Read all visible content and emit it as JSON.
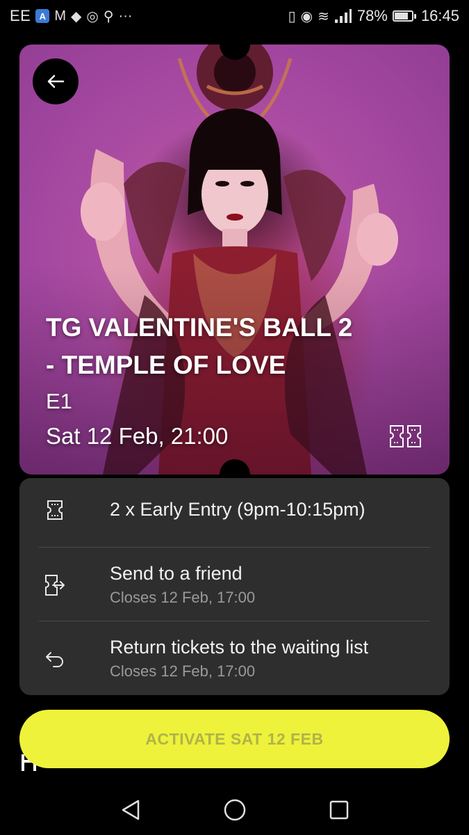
{
  "status_bar": {
    "carrier": "EE",
    "more": "···",
    "battery_percent": "78%",
    "battery_level": 0.78,
    "time": "16:45"
  },
  "event": {
    "title_line1": "TG VALENTINE'S BALL 2",
    "title_line2": "- TEMPLE OF LOVE",
    "venue": "E1",
    "date_time": "Sat 12 Feb, 21:00"
  },
  "options": {
    "ticket_summary": "2 x Early Entry (9pm-10:15pm)",
    "send_label": "Send to a friend",
    "send_sub": "Closes 12 Feb, 17:00",
    "return_label": "Return tickets to the waiting list",
    "return_sub": "Closes 12 Feb, 17:00"
  },
  "activate_label": "ACTIVATE SAT 12 FEB",
  "colors": {
    "accent": "#eef23a",
    "panel": "#2e2e2e",
    "background": "#000000"
  },
  "icons": [
    "back-arrow-icon",
    "tickets-icon",
    "ticket-icon",
    "send-ticket-icon",
    "return-arrow-icon",
    "nav-back-icon",
    "nav-home-icon",
    "nav-recents-icon"
  ]
}
